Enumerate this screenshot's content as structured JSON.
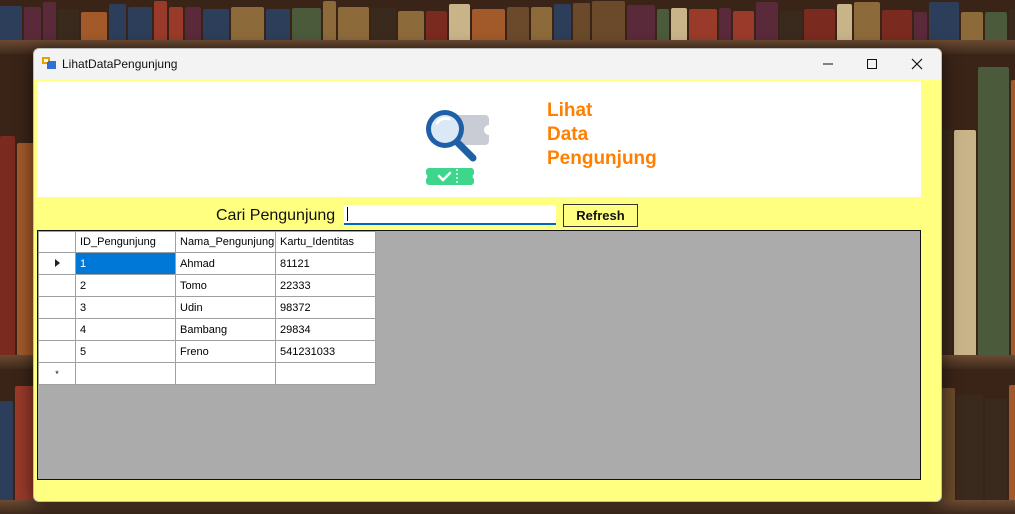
{
  "window": {
    "title": "LihatDataPengunjung"
  },
  "header": {
    "title_lines": [
      "Lihat",
      "Data",
      "Pengunjung"
    ]
  },
  "search": {
    "label": "Cari Pengunjung",
    "value": "",
    "refresh_label": "Refresh"
  },
  "grid": {
    "columns": [
      "ID_Pengunjung",
      "Nama_Pengunjung",
      "Kartu_Identitas"
    ],
    "rows": [
      [
        "1",
        "Ahmad",
        "81121"
      ],
      [
        "2",
        "Tomo",
        "22333"
      ],
      [
        "3",
        "Udin",
        "98372"
      ],
      [
        "4",
        "Bambang",
        "29834"
      ],
      [
        "5",
        "Freno",
        "541231033"
      ]
    ],
    "new_row_marker": "*"
  },
  "colors": {
    "form_bg": "#ffff80",
    "title_accent": "#ff8000",
    "selection": "#0078d7",
    "grid_bg": "#ababab"
  }
}
